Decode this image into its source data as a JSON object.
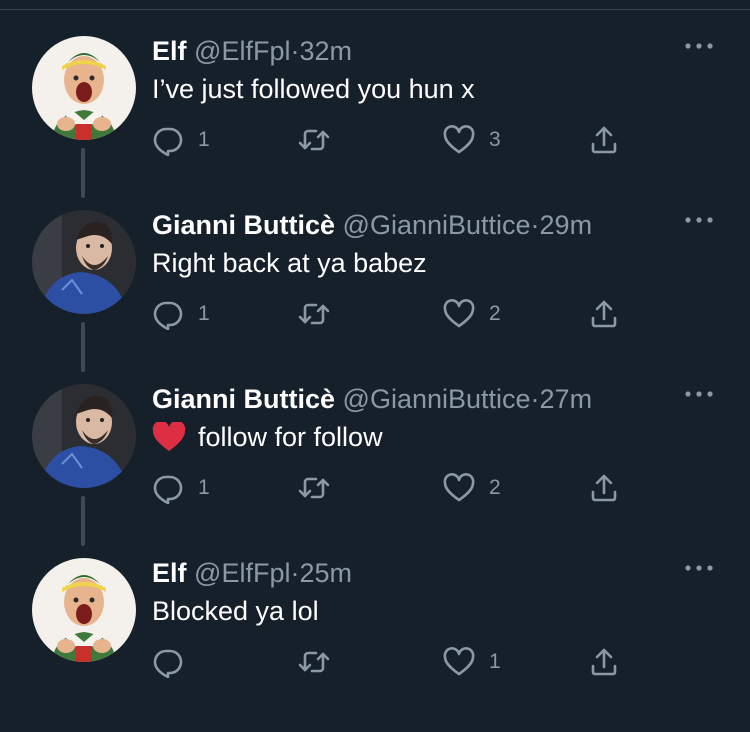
{
  "tweets": [
    {
      "name": "Elf",
      "handle": "@ElfFpl",
      "dot": "·",
      "time": "32m",
      "text": "I’ve just followed you hun x",
      "reply_count": "1",
      "retweet_count": "",
      "like_count": "3",
      "avatar": "elf-avatar"
    },
    {
      "name": "Gianni Butticè",
      "handle": "@GianniButtice",
      "dot": "·",
      "time": "29m",
      "text": "Right back at ya babez",
      "reply_count": "1",
      "retweet_count": "",
      "like_count": "2",
      "avatar": "gianni-avatar"
    },
    {
      "name": "Gianni Butticè",
      "handle": "@GianniButtice",
      "dot": "·",
      "time": "27m",
      "text": "follow for follow",
      "emoji": "red-heart",
      "reply_count": "1",
      "retweet_count": "",
      "like_count": "2",
      "avatar": "gianni-avatar"
    },
    {
      "name": "Elf",
      "handle": "@ElfFpl",
      "dot": "·",
      "time": "25m",
      "text": "Blocked ya lol",
      "reply_count": "",
      "retweet_count": "",
      "like_count": "1",
      "avatar": "elf-avatar"
    }
  ],
  "icons": {
    "reply": "reply-icon",
    "retweet": "retweet-icon",
    "like": "heart-icon",
    "share": "share-icon",
    "more": "more-icon"
  },
  "colors": {
    "background": "#15202b",
    "secondary_text": "#8b98a5",
    "thread_line": "#3d4a55"
  }
}
